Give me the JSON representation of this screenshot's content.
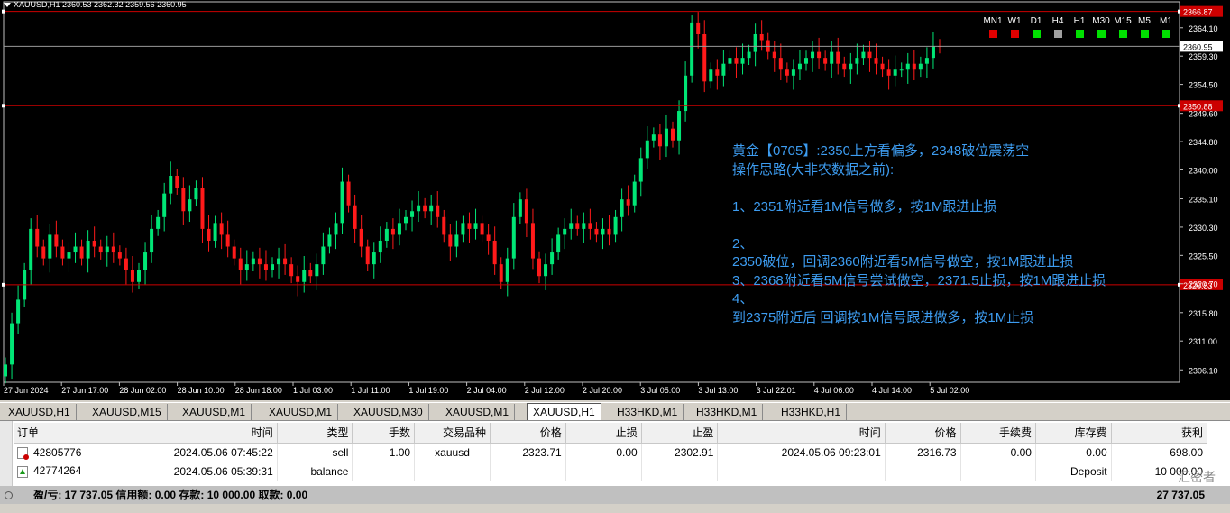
{
  "header": {
    "symbol_info": "XAUUSD,H1  2360.53 2362.32 2359.56 2360.95"
  },
  "timeframes": [
    {
      "label": "MN1",
      "status": "red"
    },
    {
      "label": "W1",
      "status": "red"
    },
    {
      "label": "D1",
      "status": "green"
    },
    {
      "label": "H4",
      "status": "gray"
    },
    {
      "label": "H1",
      "status": "green"
    },
    {
      "label": "M30",
      "status": "green"
    },
    {
      "label": "M15",
      "status": "green"
    },
    {
      "label": "M5",
      "status": "green"
    },
    {
      "label": "M1",
      "status": "green"
    }
  ],
  "colors": {
    "red": "#e00000",
    "green": "#00e000",
    "gray": "#a0a0a0",
    "bull": "#00e676",
    "bear": "#ff1a1a",
    "level_line": "#cc0000",
    "analysis_text": "#3d9cf0"
  },
  "analysis": [
    "黄金【0705】:2350上方看偏多，2348破位震荡空",
    "操作思路(大非农数据之前):",
    "",
    "1、2351附近看1M信号做多，按1M跟进止损",
    "",
    "2、",
    "2350破位，回调2360附近看5M信号做空，按1M跟进止损",
    "3、2368附近看5M信号尝试做空，2371.5止损，按1M跟进止损",
    "4、",
    "到2375附近后 回调按1M信号跟进做多，按1M止损"
  ],
  "chart_data": {
    "type": "candlestick",
    "ylim": [
      2304,
      2368.5
    ],
    "y_ticks": [
      "2364.10",
      "2359.30",
      "2354.50",
      "2349.60",
      "2344.80",
      "2340.00",
      "2335.10",
      "2330.30",
      "2325.50",
      "2320.70",
      "2315.80",
      "2311.00",
      "2306.10"
    ],
    "x_ticks": [
      "27 Jun 2024",
      "27 Jun 17:00",
      "28 Jun 02:00",
      "28 Jun 10:00",
      "28 Jun 18:00",
      "1 Jul 03:00",
      "1 Jul 11:00",
      "1 Jul 19:00",
      "2 Jul 04:00",
      "2 Jul 12:00",
      "2 Jul 20:00",
      "3 Jul 05:00",
      "3 Jul 13:00",
      "3 Jul 22:01",
      "4 Jul 06:00",
      "4 Jul 14:00",
      "5 Jul 02:00"
    ],
    "levels": [
      {
        "value": 2366.87,
        "label": "2366.87"
      },
      {
        "value": 2350.88,
        "label": "2350.88"
      },
      {
        "value": 2320.53,
        "label": "2320.53"
      }
    ],
    "current_price": {
      "value": 2360.95,
      "label": "2360.95"
    },
    "closes": [
      2307,
      2314,
      2318,
      2323,
      2330,
      2327,
      2325,
      2329,
      2327,
      2325,
      2326,
      2327,
      2325,
      2328,
      2327,
      2326,
      2327,
      2326,
      2325,
      2323,
      2321,
      2323,
      2326,
      2330,
      2332,
      2336,
      2339,
      2337,
      2333,
      2335,
      2337,
      2330,
      2328,
      2331,
      2329,
      2327,
      2325,
      2323,
      2324,
      2325,
      2324,
      2323,
      2324,
      2325,
      2324,
      2322,
      2321,
      2323,
      2322,
      2324,
      2327,
      2329,
      2331,
      2338,
      2334,
      2330,
      2327,
      2324,
      2326,
      2328,
      2330,
      2329,
      2331,
      2332,
      2333,
      2334,
      2333,
      2334,
      2332,
      2329,
      2327,
      2329,
      2331,
      2330,
      2331,
      2329,
      2328,
      2324,
      2321,
      2325,
      2332,
      2335,
      2331,
      2325,
      2322,
      2324,
      2326,
      2329,
      2330,
      2331,
      2330,
      2331,
      2330,
      2329,
      2330,
      2329,
      2332,
      2335,
      2334,
      2338,
      2342,
      2345,
      2346,
      2344,
      2347,
      2345,
      2350,
      2356,
      2365,
      2363,
      2355,
      2357,
      2356,
      2358,
      2359,
      2358,
      2359,
      2360,
      2363,
      2362,
      2360,
      2359,
      2357,
      2356,
      2357,
      2358,
      2359,
      2360,
      2359,
      2358,
      2360,
      2358,
      2357,
      2358,
      2359,
      2360,
      2359,
      2358,
      2357,
      2356,
      2357,
      2357,
      2358,
      2357,
      2358,
      2359,
      2361,
      2360.95
    ]
  },
  "tabs": [
    "XAUUSD,H1",
    "XAUUSD,M15",
    "XAUUSD,M1",
    "XAUUSD,M1",
    "XAUUSD,M30",
    "XAUUSD,M1",
    "XAUUSD,H1",
    "H33HKD,M1",
    "H33HKD,M1",
    "H33HKD,H1"
  ],
  "active_tab": 6,
  "table": {
    "headers": [
      "订单",
      "时间",
      "类型",
      "手数",
      "交易品种",
      "价格",
      "止损",
      "止盈",
      "时间",
      "价格",
      "手续费",
      "库存费",
      "获利"
    ],
    "rows": [
      {
        "order": "42805776",
        "time": "2024.05.06 07:45:22",
        "type": "sell",
        "lots": "1.00",
        "symbol": "xauusd",
        "price": "2323.71",
        "sl": "0.00",
        "tp": "2302.91",
        "close_time": "2024.05.06 09:23:01",
        "close_price": "2316.73",
        "commission": "0.00",
        "swap": "0.00",
        "profit": "698.00"
      },
      {
        "order": "42774264",
        "time": "2024.05.06 05:39:31",
        "type": "balance",
        "comment": "Deposit",
        "profit": "10 000.00"
      }
    ],
    "summary": "盈/亏: 17 737.05  信用额: 0.00  存款: 10 000.00  取款: 0.00",
    "summary_total": "27 737.05"
  },
  "watermark": "汇密者"
}
